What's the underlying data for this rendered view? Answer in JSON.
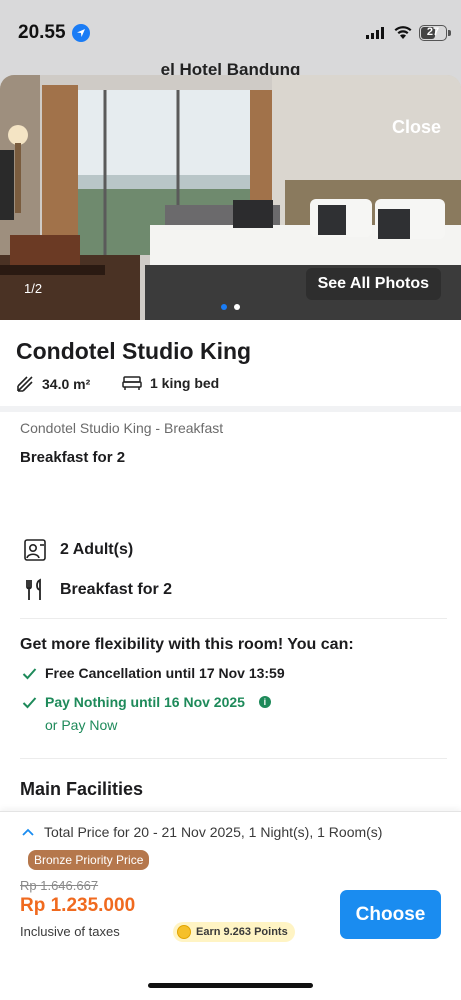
{
  "status_bar": {
    "time": "20.55",
    "battery": "27"
  },
  "behind_title": "el Hotel Bandung",
  "photo": {
    "close_label": "Close",
    "counter": "1/2",
    "see_all_label": "See All Photos"
  },
  "room": {
    "title": "Condotel Studio King",
    "size": "34.0 m²",
    "bed": "1 king bed"
  },
  "plan": {
    "name": "Condotel Studio King - Breakfast",
    "meal": "Breakfast for 2"
  },
  "details": {
    "guests": "2 Adult(s)",
    "meal": "Breakfast for 2"
  },
  "flexibility": {
    "title": "Get more flexibility with this room! You can:",
    "cancellation": "Free Cancellation until 17 Nov 13:59",
    "pay_later": "Pay Nothing until 16 Nov 2025",
    "pay_now": "or Pay Now"
  },
  "facilities_title": "Main Facilities",
  "booking": {
    "total_label": "Total Price for 20 - 21 Nov 2025, 1 Night(s), 1 Room(s)",
    "badge": "Bronze Priority Price",
    "old_price": "Rp 1.646.667",
    "new_price": "Rp 1.235.000",
    "taxes": "Inclusive of taxes",
    "points": "Earn 9.263 Points",
    "choose_label": "Choose"
  },
  "colors": {
    "accent": "#1a8cf0",
    "price": "#f06a1f",
    "green": "#1e8a5a",
    "badge": "#b5774c"
  }
}
